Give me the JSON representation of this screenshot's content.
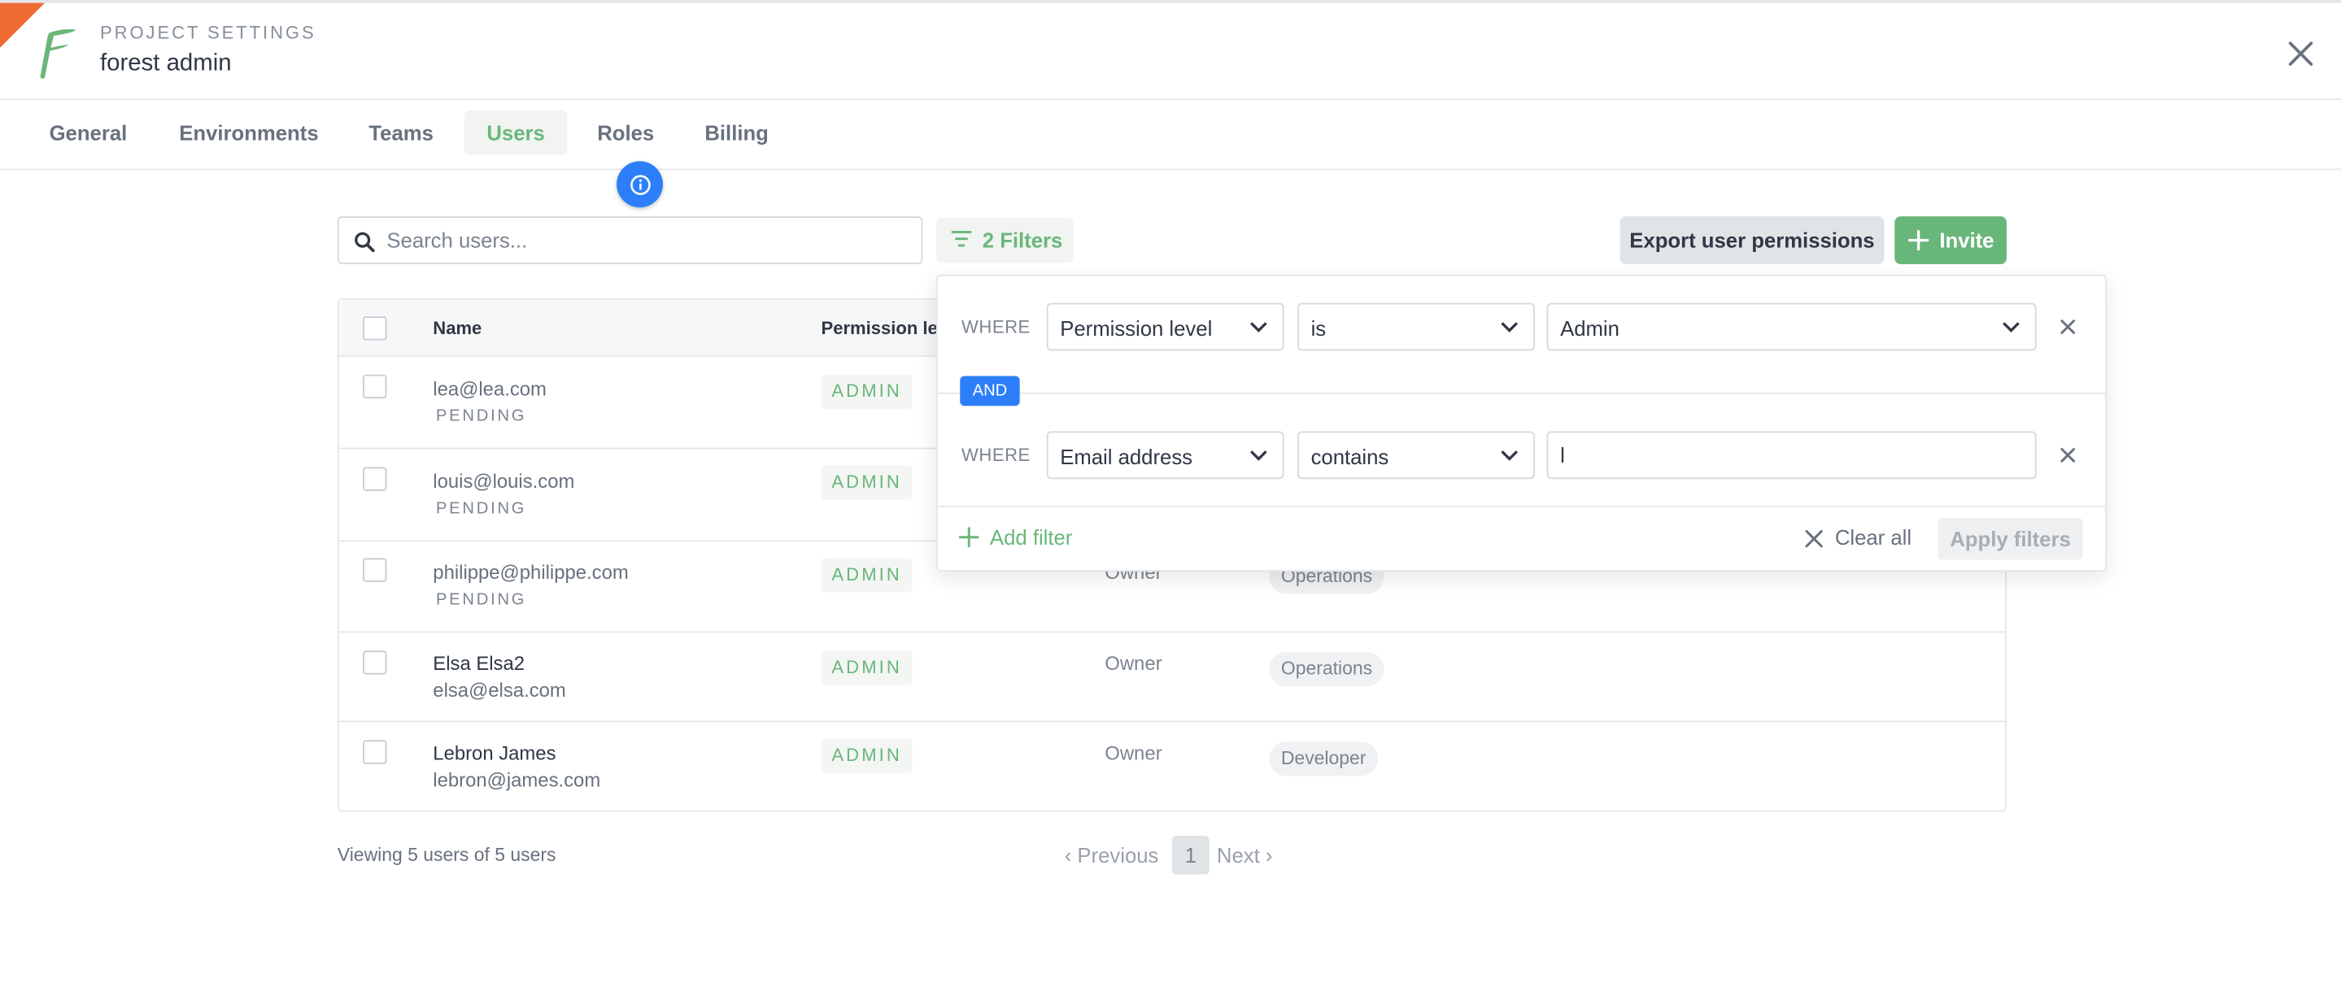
{
  "colors": {
    "accent": "#69b67a",
    "info": "#2d7ff9",
    "brand_corner": "#ef6a33"
  },
  "header": {
    "eyebrow": "PROJECT SETTINGS",
    "project_name": "forest admin"
  },
  "tabs": [
    {
      "label": "General"
    },
    {
      "label": "Environments"
    },
    {
      "label": "Teams"
    },
    {
      "label": "Users",
      "active": true
    },
    {
      "label": "Roles"
    },
    {
      "label": "Billing"
    }
  ],
  "toolbar": {
    "search_placeholder": "Search users...",
    "filters_label": "2 Filters",
    "export_label": "Export user permissions",
    "invite_label": "Invite"
  },
  "table": {
    "columns": {
      "name": "Name",
      "permission": "Permission lev"
    },
    "rows": [
      {
        "primary": "lea@lea.com",
        "secondary": "PENDING",
        "pending": true,
        "permission": "ADMIN",
        "role": "",
        "team": ""
      },
      {
        "primary": "louis@louis.com",
        "secondary": "PENDING",
        "pending": true,
        "permission": "ADMIN",
        "role": "",
        "team": ""
      },
      {
        "primary": "philippe@philippe.com",
        "secondary": "PENDING",
        "pending": true,
        "permission": "ADMIN",
        "role": "Owner",
        "team": "Operations"
      },
      {
        "primary": "Elsa Elsa2",
        "secondary": "elsa@elsa.com",
        "pending": false,
        "permission": "ADMIN",
        "role": "Owner",
        "team": "Operations"
      },
      {
        "primary": "Lebron James",
        "secondary": "lebron@james.com",
        "pending": false,
        "permission": "ADMIN",
        "role": "Owner",
        "team": "Developer"
      }
    ]
  },
  "footer": {
    "viewing": "Viewing 5 users of 5 users",
    "previous": "‹ Previous",
    "page": "1",
    "next": "Next ›"
  },
  "filter_popover": {
    "conditions": [
      {
        "where": "WHERE",
        "field": "Permission level",
        "operator": "is",
        "value": "Admin",
        "value_type": "select"
      },
      {
        "where": "WHERE",
        "field": "Email address",
        "operator": "contains",
        "value": "l",
        "value_type": "text"
      }
    ],
    "conjunction": "AND",
    "add_filter": "Add filter",
    "clear_all": "Clear all",
    "apply": "Apply filters"
  }
}
